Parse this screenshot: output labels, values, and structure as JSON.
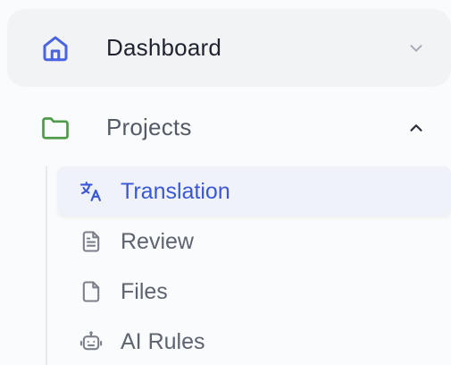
{
  "nav": {
    "dashboard": {
      "label": "Dashboard",
      "icon": "home-icon",
      "chevron": "chevron-down-icon"
    },
    "projects": {
      "label": "Projects",
      "icon": "folder-icon",
      "chevron": "chevron-up-icon",
      "expanded": true,
      "children": [
        {
          "label": "Translation",
          "icon": "translate-icon",
          "active": true
        },
        {
          "label": "Review",
          "icon": "document-icon",
          "active": false
        },
        {
          "label": "Files",
          "icon": "file-icon",
          "active": false
        },
        {
          "label": "AI Rules",
          "icon": "robot-icon",
          "active": false
        }
      ]
    }
  },
  "colors": {
    "accent": "#3a57d6",
    "home_icon": "#4a63e0",
    "folder_icon": "#4f9a4a",
    "muted_text": "#5d636f",
    "active_background": "#eff2f9"
  }
}
